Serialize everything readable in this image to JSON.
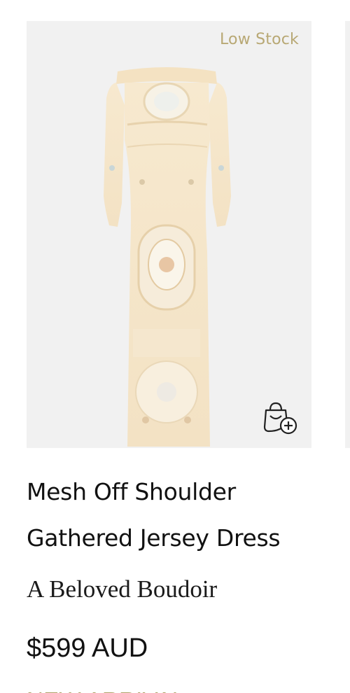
{
  "product": {
    "stock_label": "Low Stock",
    "title_line1": "Mesh Off Shoulder",
    "title_line2": "Gathered Jersey Dress",
    "collection": "A Beloved Boudoir",
    "price": "$599 AUD",
    "badge": "NEW ARRIVAL",
    "image_icon": "dress-product-image",
    "cart_icon": "shopping-bag-plus-icon"
  },
  "colors": {
    "image_bg": "#f1f1f1",
    "stock_label": "#b8a874",
    "badge": "#b0a36a",
    "text": "#111111"
  }
}
